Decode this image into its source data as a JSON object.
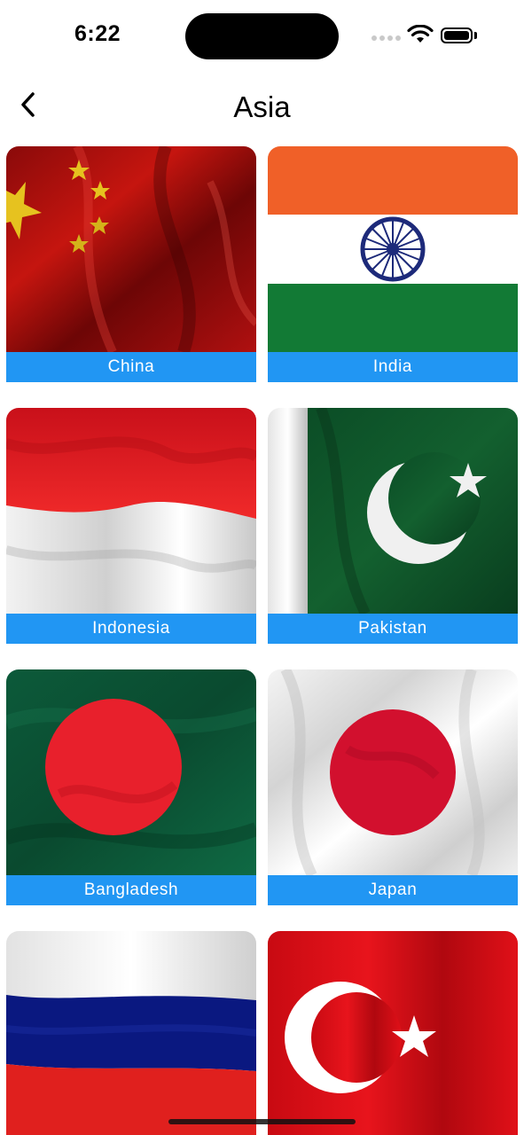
{
  "status_bar": {
    "time": "6:22"
  },
  "nav": {
    "back_icon": "chevron-left-icon",
    "title": "Asia"
  },
  "colors": {
    "label_bar": "#2196f3",
    "label_text": "#ffffff"
  },
  "countries": [
    {
      "name": "China",
      "flag_icon": "china-flag"
    },
    {
      "name": "India",
      "flag_icon": "india-flag"
    },
    {
      "name": "Indonesia",
      "flag_icon": "indonesia-flag"
    },
    {
      "name": "Pakistan",
      "flag_icon": "pakistan-flag"
    },
    {
      "name": "Bangladesh",
      "flag_icon": "bangladesh-flag"
    },
    {
      "name": "Japan",
      "flag_icon": "japan-flag"
    },
    {
      "name": "Russia",
      "flag_icon": "russia-flag"
    },
    {
      "name": "Turkey",
      "flag_icon": "turkey-flag"
    }
  ]
}
